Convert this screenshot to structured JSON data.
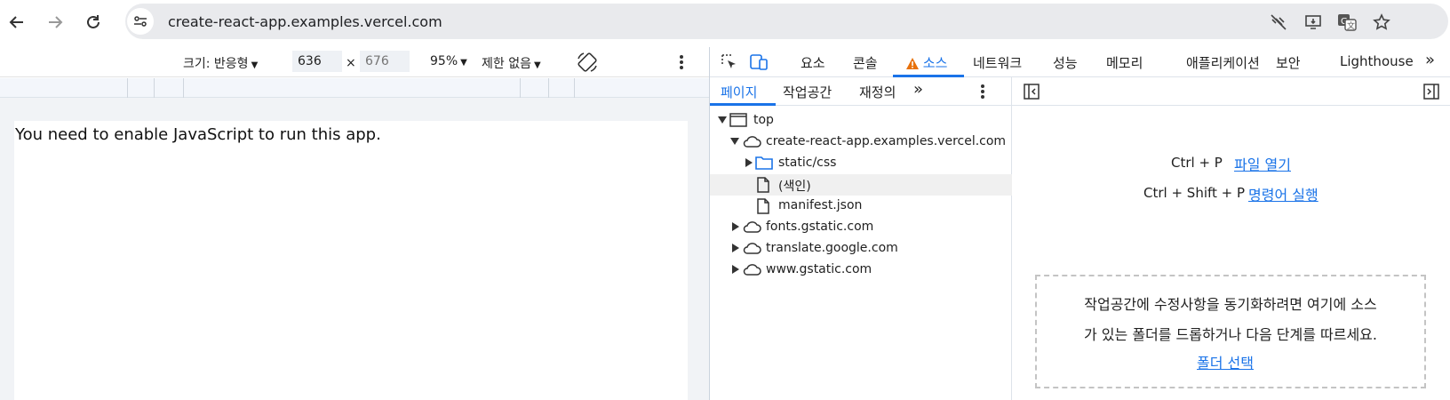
{
  "browser": {
    "url": "create-react-app.examples.vercel.com",
    "icons": [
      "back-icon",
      "forward-icon",
      "reload-icon",
      "site-info-icon",
      "no-tracking-icon",
      "install-app-icon",
      "translate-icon",
      "bookmark-star-icon"
    ]
  },
  "device_toolbar": {
    "size_label": "크기: 반응형",
    "width_value": "636",
    "times": "×",
    "height_placeholder": "676",
    "zoom": "95%",
    "throttle": "제한 없음"
  },
  "page": {
    "noscript_text": "You need to enable JavaScript to run this app."
  },
  "devtools": {
    "tabs": {
      "elements": "요소",
      "console": "콘솔",
      "sources": "소스",
      "network": "네트워크",
      "performance": "성능",
      "memory": "메모리",
      "application": "애플리케이션",
      "security": "보안",
      "lighthouse": "Lighthouse",
      "more": "»"
    },
    "sub_tabs": {
      "page": "페이지",
      "workspace": "작업공간",
      "overrides": "재정의",
      "more": "»"
    },
    "tree": {
      "top": "top",
      "origin": "create-react-app.examples.vercel.com",
      "static_css": "static/css",
      "index": "(색인)",
      "manifest": "manifest.json",
      "fonts": "fonts.gstatic.com",
      "translate": "translate.google.com",
      "gstatic": "www.gstatic.com"
    },
    "right": {
      "open_file_shortcut": "Ctrl + P",
      "open_file_link": "파일 열기",
      "run_command_shortcut": "Ctrl + Shift + P",
      "run_command_link": "명령어 실행",
      "drop_line1": "작업공간에 수정사항을 동기화하려면 여기에 소스",
      "drop_line2": "가 있는 폴더를 드롭하거나 다음 단계를 따르세요.",
      "select_folder_link": "폴더 선택"
    }
  },
  "colors": {
    "accent": "#1a73e8",
    "warning": "#e8710a"
  }
}
